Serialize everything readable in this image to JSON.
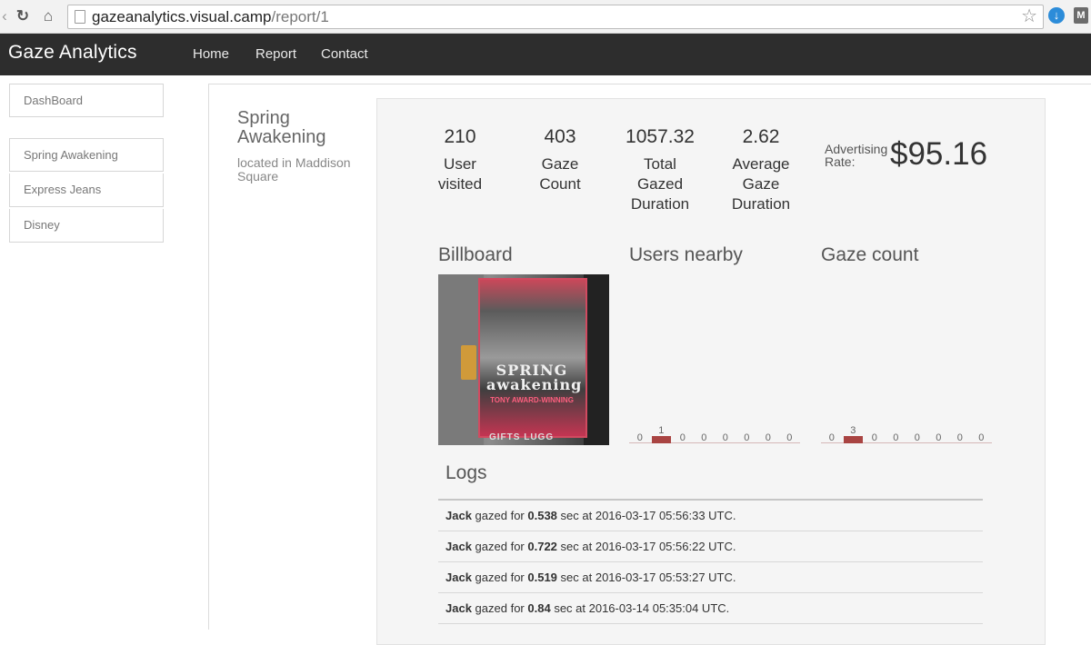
{
  "browser": {
    "url_host": "gazeanalytics.visual.camp",
    "url_path": "/report/1",
    "icons": [
      "back-icon",
      "reload-icon",
      "home-icon",
      "page-icon",
      "star-icon",
      "download-extension-icon",
      "menu-extension-icon"
    ]
  },
  "navbar": {
    "brand": "Gaze Analytics",
    "links": [
      "Home",
      "Report",
      "Contact"
    ],
    "background": "#2d2d2d"
  },
  "sidebar": {
    "dashboard": "DashBoard",
    "campaigns": [
      "Spring Awakening",
      "Express Jeans",
      "Disney"
    ]
  },
  "campaign": {
    "title": "Spring Awakening",
    "location": "located in Maddison Square"
  },
  "stats": [
    {
      "value": "210",
      "label": "User visited"
    },
    {
      "value": "403",
      "label": "Gaze Count"
    },
    {
      "value": "1057.32",
      "label": "Total Gazed Duration"
    },
    {
      "value": "2.62",
      "label": "Average Gaze Duration"
    }
  ],
  "advertising": {
    "label": "Advertising Rate:",
    "value": "$95.16"
  },
  "sections": {
    "billboard": "Billboard",
    "users_nearby": "Users nearby",
    "gaze_count": "Gaze count",
    "logs": "Logs"
  },
  "billboard_image": {
    "text_main": "SPRING awakening",
    "text_sub": "TONY AWARD-WINNING",
    "store_sign": "GIFTS LUGG"
  },
  "chart_data": [
    {
      "type": "bar",
      "name": "users_nearby",
      "categories": [
        "1",
        "2",
        "3",
        "4",
        "5",
        "6",
        "7",
        "8"
      ],
      "values": [
        0,
        1,
        0,
        0,
        0,
        0,
        0,
        0
      ],
      "labels": [
        "0",
        "1",
        "0",
        "0",
        "0",
        "0",
        "0",
        "0"
      ],
      "color": "#a94442"
    },
    {
      "type": "bar",
      "name": "gaze_count",
      "categories": [
        "1",
        "2",
        "3",
        "4",
        "5",
        "6",
        "7",
        "8"
      ],
      "values": [
        0,
        3,
        0,
        0,
        0,
        0,
        0,
        0
      ],
      "labels": [
        "0",
        "3",
        "0",
        "0",
        "0",
        "0",
        "0",
        "0"
      ],
      "color": "#a94442"
    }
  ],
  "logs": [
    {
      "user": "Jack",
      "mid": "gazed for",
      "duration": "0.538",
      "rest": "sec at 2016-03-17 05:56:33 UTC."
    },
    {
      "user": "Jack",
      "mid": "gazed for",
      "duration": "0.722",
      "rest": "sec at 2016-03-17 05:56:22 UTC."
    },
    {
      "user": "Jack",
      "mid": "gazed for",
      "duration": "0.519",
      "rest": "sec at 2016-03-17 05:53:27 UTC."
    },
    {
      "user": "Jack",
      "mid": "gazed for",
      "duration": "0.84",
      "rest": "sec at 2016-03-14 05:35:04 UTC."
    }
  ]
}
